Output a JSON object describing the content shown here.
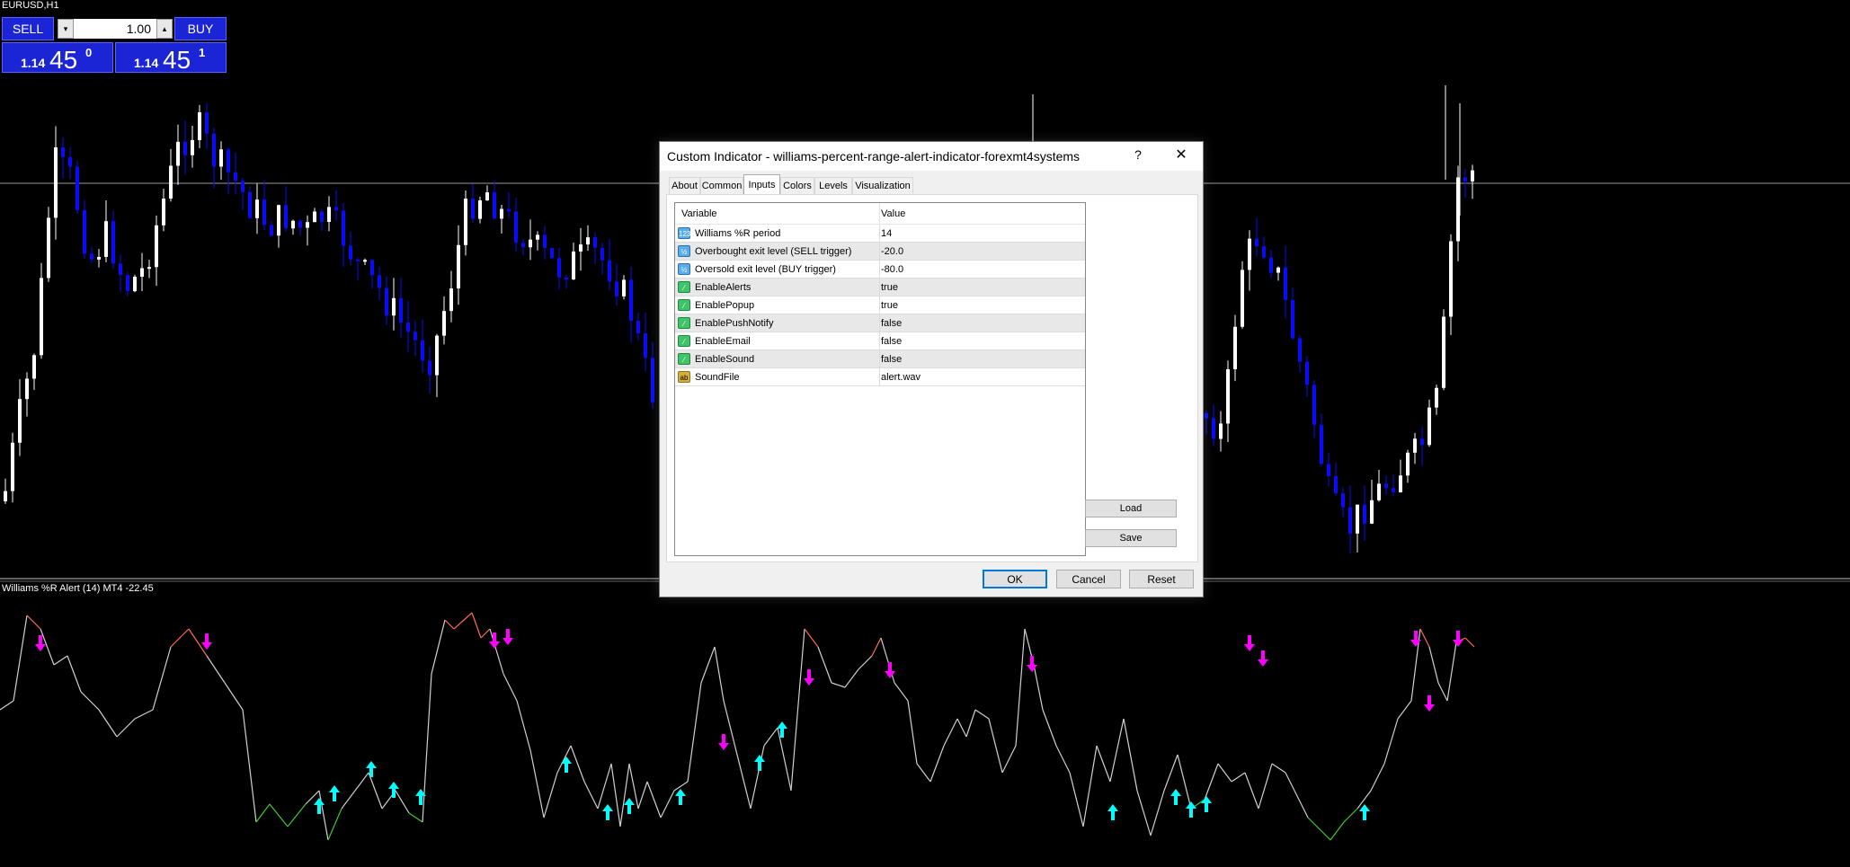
{
  "chart": {
    "symbol": "EURUSD,H1",
    "subwindow_title": "Williams %R Alert (14) MT4 -22.45",
    "colors": {
      "bull_candle": "#ffffff",
      "bear_candle": "#0a0aff",
      "wpr_line": "#d0d0d0",
      "overbought": "#ff6a4d",
      "oversold": "#3ccc2a",
      "sell_arrow": "#ff00ff",
      "buy_arrow": "#00ffff",
      "background": "#000000"
    }
  },
  "trade_panel": {
    "sell_label": "SELL",
    "buy_label": "BUY",
    "lot": "1.00",
    "down_glyph": "▾",
    "up_glyph": "▴",
    "sell_price": {
      "small": "1.14",
      "big": "45",
      "sup": "0"
    },
    "buy_price": {
      "small": "1.14",
      "big": "45",
      "sup": "1"
    }
  },
  "dialog": {
    "title": "Custom Indicator - williams-percent-range-alert-indicator-forexmt4systems",
    "help": "?",
    "close": "✕",
    "tabs": [
      "About",
      "Common",
      "Inputs",
      "Colors",
      "Levels",
      "Visualization"
    ],
    "active_tab": "Inputs",
    "columns": {
      "variable": "Variable",
      "value": "Value"
    },
    "params": [
      {
        "type": "num",
        "icon": "123",
        "name": "Williams %R period",
        "value": "14"
      },
      {
        "type": "num",
        "icon": "½",
        "name": "Overbought exit level (SELL trigger)",
        "value": "-20.0"
      },
      {
        "type": "num",
        "icon": "½",
        "name": "Oversold exit level (BUY trigger)",
        "value": "-80.0"
      },
      {
        "type": "bool",
        "icon": "⁄",
        "name": "EnableAlerts",
        "value": "true"
      },
      {
        "type": "bool",
        "icon": "⁄",
        "name": "EnablePopup",
        "value": "true"
      },
      {
        "type": "bool",
        "icon": "⁄",
        "name": "EnablePushNotify",
        "value": "false"
      },
      {
        "type": "bool",
        "icon": "⁄",
        "name": "EnableEmail",
        "value": "false"
      },
      {
        "type": "bool",
        "icon": "⁄",
        "name": "EnableSound",
        "value": "false"
      },
      {
        "type": "str",
        "icon": "ab",
        "name": "SoundFile",
        "value": "alert.wav"
      }
    ],
    "load_label": "Load",
    "save_label": "Save",
    "ok_label": "OK",
    "cancel_label": "Cancel",
    "reset_label": "Reset"
  }
}
